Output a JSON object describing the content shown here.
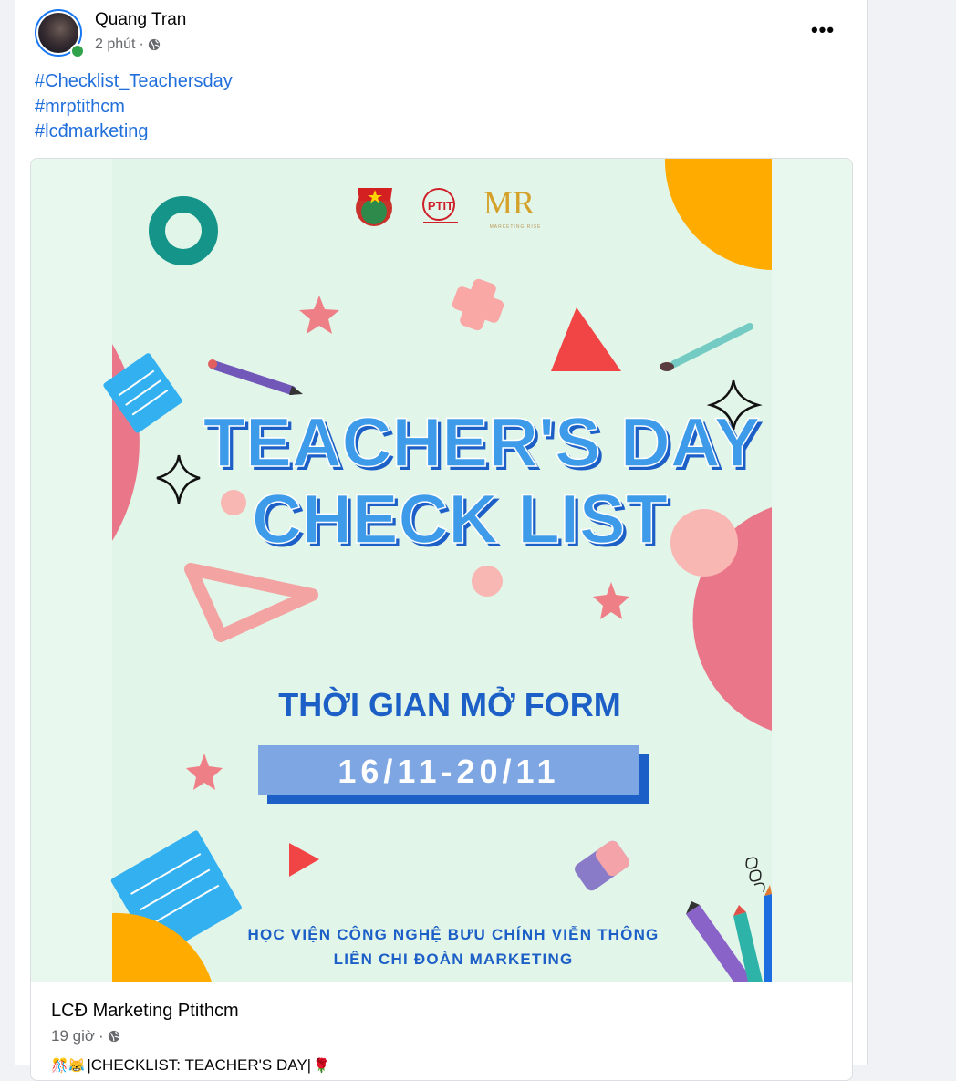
{
  "post": {
    "author": "Quang Tran",
    "time": "2 phút",
    "separator": "·",
    "hashtags": [
      "#Checklist_Teachersday",
      "#mrptithcm",
      "#lcđmarketing"
    ],
    "more_label": "•••"
  },
  "image": {
    "title_line1": "TEACHER'S DAY",
    "title_line2": "CHECK LIST",
    "subtitle": "THỜI GIAN MỞ FORM",
    "dates": "16/11-20/11",
    "org_line1": "HỌC VIỆN CÔNG NGHỆ BƯU CHÍNH VIỄN THÔNG",
    "org_line2": "LIÊN CHI ĐOÀN MARKETING",
    "logo_ptit": "PTIT",
    "logo_mr": "MR",
    "logo_mr_sub": "MARKETING RISE"
  },
  "shared": {
    "page_name": "LCĐ Marketing Ptithcm",
    "time": "19 giờ",
    "separator": "·",
    "snippet_emoji": "🎊😹",
    "snippet_text": "|CHECKLIST: TEACHER'S DAY|",
    "snippet_emoji_end": "🌹"
  },
  "colors": {
    "link": "#216fdb",
    "image_bg": "#e2f5e9",
    "title_blue": "#3d9be9",
    "title_shadow": "#1c5fc7",
    "date_box": "#7ea6e3"
  },
  "icons": {
    "globe": "globe-icon",
    "more": "more-icon"
  }
}
